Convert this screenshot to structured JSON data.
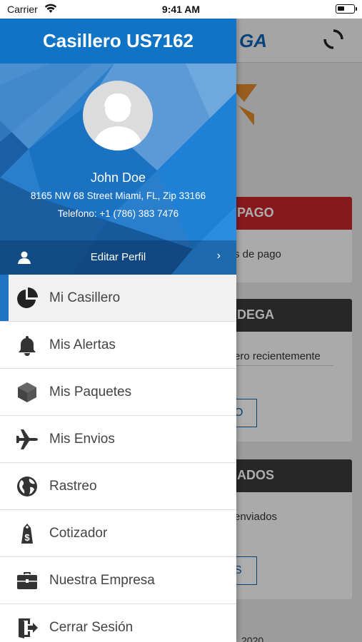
{
  "status_bar": {
    "carrier": "Carrier",
    "time": "9:41 AM"
  },
  "drawer": {
    "title": "Casillero US7162",
    "profile": {
      "name": "John Doe",
      "address": "8165 NW 68 Street Miami, FL, Zip 33166",
      "phone": "Telefono: +1 (786) 383 7476",
      "edit_label": "Editar Perfil"
    },
    "menu": [
      {
        "label": "Mi Casillero",
        "icon": "pie-chart-icon",
        "active": true
      },
      {
        "label": "Mis Alertas",
        "icon": "bell-icon"
      },
      {
        "label": "Mis Paquetes",
        "icon": "package-icon"
      },
      {
        "label": "Mis Envios",
        "icon": "airplane-icon"
      },
      {
        "label": "Rastreo",
        "icon": "globe-icon"
      },
      {
        "label": "Cotizador",
        "icon": "price-tag-icon"
      },
      {
        "label": "Nuestra Empresa",
        "icon": "briefcase-icon"
      },
      {
        "label": "Cerrar Sesión",
        "icon": "logout-icon"
      }
    ]
  },
  "background": {
    "logo_text": "GA",
    "cards": [
      {
        "header": "PAGO",
        "line": "s de pago"
      },
      {
        "header": "DEGA",
        "line": "ero recientemente",
        "button": "O"
      },
      {
        "header": "ADOS",
        "line": "enviados",
        "button": "S"
      }
    ],
    "footer": "2020"
  },
  "colors": {
    "primary": "#0f73c6",
    "accent_red": "#c8262c",
    "accent_dark": "#3a3a3a"
  }
}
